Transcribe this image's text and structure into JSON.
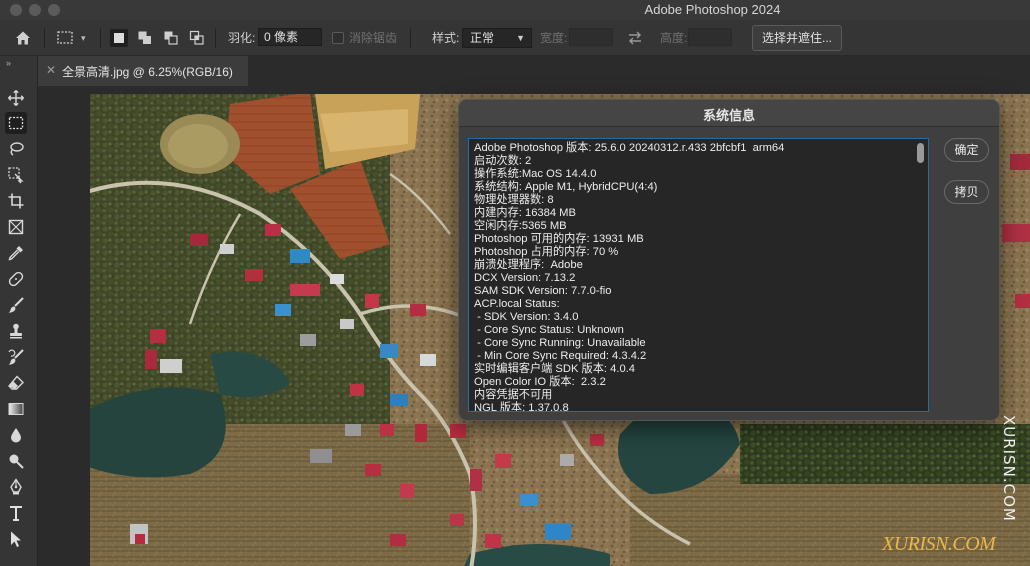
{
  "app_title": "Adobe Photoshop 2024",
  "options_bar": {
    "feather_label": "羽化:",
    "feather_value": "0 像素",
    "antialias_label": "消除锯齿",
    "style_label": "样式:",
    "style_value": "正常",
    "width_label": "宽度:",
    "height_label": "高度:",
    "select_mask_button": "选择并遮住..."
  },
  "document_tab": {
    "title": "全景高清.jpg @ 6.25%(RGB/16)"
  },
  "toolbar": {
    "tools": [
      "move-tool",
      "marquee-tool",
      "lasso-tool",
      "object-select-tool",
      "crop-tool",
      "frame-tool",
      "eyedropper-tool",
      "healing-brush-tool",
      "brush-tool",
      "clone-stamp-tool",
      "history-brush-tool",
      "eraser-tool",
      "gradient-tool",
      "blur-tool",
      "dodge-tool",
      "pen-tool",
      "type-tool",
      "path-select-tool"
    ]
  },
  "dialog": {
    "title": "系统信息",
    "ok_button": "确定",
    "copy_button": "拷贝",
    "info_lines": [
      "Adobe Photoshop 版本: 25.6.0 20240312.r.433 2bfcbf1  arm64",
      "启动次数: 2",
      "操作系统:Mac OS 14.4.0",
      "系统结构: Apple M1, HybridCPU(4:4)",
      "物理处理器数: 8",
      "内建内存: 16384 MB",
      "空闲内存:5365 MB",
      "Photoshop 可用的内存: 13931 MB",
      "Photoshop 占用的内存: 70 %",
      "崩溃处理程序:  Adobe",
      "DCX Version: 7.13.2",
      "SAM SDK Version: 7.7.0-fio",
      "ACP.local Status:",
      " - SDK Version: 3.4.0",
      " - Core Sync Status: Unknown",
      " - Core Sync Running: Unavailable",
      " - Min Core Sync Required: 4.3.4.2",
      "实时编辑客户端 SDK 版本: 4.0.4",
      "Open Color IO 版本:  2.3.2",
      "内容凭据不可用",
      "NGL 版本: 1.37.0.8"
    ]
  },
  "watermark": {
    "vertical": "XURISN.COM",
    "bottom": "XURISN.COM"
  },
  "colors": {
    "accent_focus": "#2d6aa3",
    "watermark_gold": "#e8b84a"
  }
}
